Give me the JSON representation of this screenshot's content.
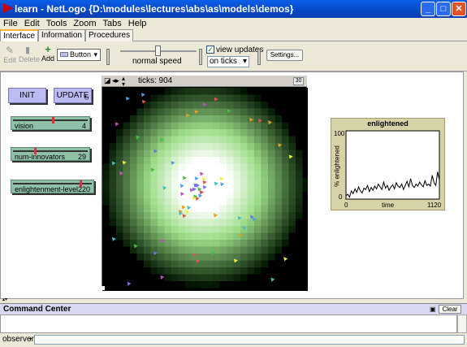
{
  "window": {
    "title": "learn - NetLogo {D:\\modules\\lectures\\abs\\as\\models\\demos}",
    "minimize": "_",
    "maximize": "□",
    "close": "✕"
  },
  "menu": [
    "File",
    "Edit",
    "Tools",
    "Zoom",
    "Tabs",
    "Help"
  ],
  "tabs": [
    "Interface",
    "Information",
    "Procedures"
  ],
  "toolbar": {
    "edit": "Edit",
    "delete": "Delete",
    "add": "Add",
    "widget_type": "Button",
    "speed_label": "normal speed",
    "view_updates_label": "view updates",
    "view_updates_checked": true,
    "update_mode": "on ticks",
    "settings": "Settings..."
  },
  "buttons": {
    "init": "INIT",
    "update": "UPDATE"
  },
  "sliders": [
    {
      "name": "vision",
      "value": "4",
      "fraction": 0.55
    },
    {
      "name": "num-innovators",
      "value": "29",
      "fraction": 0.3
    },
    {
      "name": "enlightenment-level",
      "value": "220",
      "fraction": 0.88
    }
  ],
  "view": {
    "ticks_label": "ticks: 904",
    "speed_box": "30"
  },
  "plot": {
    "title": "enlightened",
    "ylabel": "% enlightened",
    "xlabel": "time",
    "y_max": "100",
    "y_min": "0",
    "x_min": "0",
    "x_max": "1120"
  },
  "chart_data": {
    "type": "line",
    "title": "enlightened",
    "xlabel": "time",
    "ylabel": "% enlightened",
    "xlim": [
      0,
      1120
    ],
    "ylim": [
      0,
      100
    ],
    "series": [
      {
        "values": [
          5,
          7,
          3,
          12,
          8,
          15,
          10,
          18,
          12,
          9,
          16,
          14,
          20,
          11,
          17,
          13,
          19,
          15,
          22,
          18,
          14,
          25,
          16,
          20,
          13,
          18,
          21,
          15,
          24,
          19,
          17,
          22,
          14,
          20,
          26,
          18,
          30,
          20,
          17,
          22,
          19,
          25,
          21,
          18,
          27,
          20,
          22,
          19,
          35,
          24,
          20,
          40,
          28
        ]
      }
    ]
  },
  "command_center": {
    "title": "Command Center",
    "clear": "Clear",
    "prompt": "observer>"
  }
}
